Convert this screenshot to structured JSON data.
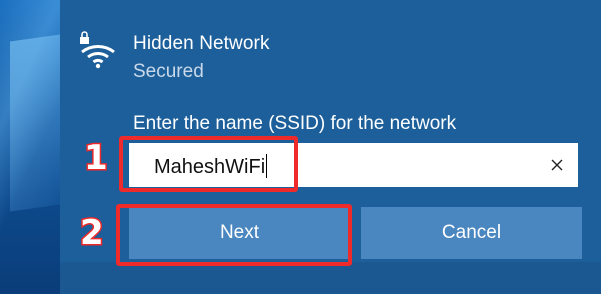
{
  "network": {
    "name": "Hidden Network",
    "status": "Secured",
    "icon": "wifi-lock-icon"
  },
  "ssid": {
    "label": "Enter the name (SSID) for the network",
    "value": "MaheshWiFi"
  },
  "buttons": {
    "next": "Next",
    "cancel": "Cancel"
  },
  "annotations": {
    "step1": "1",
    "step2": "2"
  },
  "colors": {
    "panel": "#1d5f9a",
    "button": "#4a86c0",
    "highlight": "#ee2a2a"
  }
}
